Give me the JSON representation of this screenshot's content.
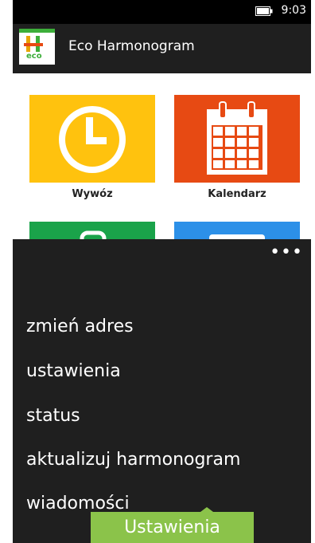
{
  "status_bar": {
    "time": "9:03"
  },
  "app_bar": {
    "title": "Eco Harmonogram",
    "logo_text": "eco"
  },
  "tiles": [
    {
      "label": "Wywóz",
      "icon": "clock-icon",
      "color": "#ffc20e"
    },
    {
      "label": "Kalendarz",
      "icon": "calendar-icon",
      "color": "#e74a13"
    },
    {
      "label": "",
      "icon": "tile-icon-green",
      "color": "#1aa34a"
    },
    {
      "label": "",
      "icon": "tile-icon-blue",
      "color": "#2c90e8"
    }
  ],
  "menu": {
    "more_label": "•••",
    "items": [
      "zmień adres",
      "ustawienia",
      "status",
      "aktualizuj harmonogram",
      "wiadomości"
    ]
  },
  "toast": {
    "text": "Ustawienia"
  },
  "colors": {
    "accent_green": "#8bc34a",
    "panel": "#1f1f1f"
  }
}
